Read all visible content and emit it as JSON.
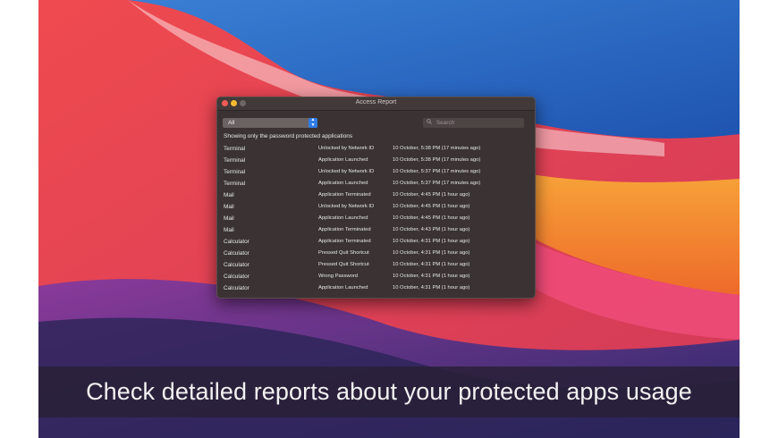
{
  "window": {
    "title": "Access Report"
  },
  "filter": {
    "selected": "All"
  },
  "search": {
    "placeholder": "Search"
  },
  "notice": "Showing only the password protected applications",
  "rows": [
    {
      "app": "Terminal",
      "event": "Unlocked by Network ID",
      "time": "10 October, 5:38 PM (17 minutes ago)"
    },
    {
      "app": "Terminal",
      "event": "Application Launched",
      "time": "10 October, 5:38 PM (17 minutes ago)"
    },
    {
      "app": "Terminal",
      "event": "Unlocked by Network ID",
      "time": "10 October, 5:37 PM (17 minutes ago)"
    },
    {
      "app": "Terminal",
      "event": "Application Launched",
      "time": "10 October, 5:37 PM (17 minutes ago)"
    },
    {
      "app": "Mail",
      "event": "Application Terminated",
      "time": "10 October, 4:45 PM (1 hour ago)"
    },
    {
      "app": "Mail",
      "event": "Unlocked by Network ID",
      "time": "10 October, 4:45 PM (1 hour ago)"
    },
    {
      "app": "Mail",
      "event": "Application Launched",
      "time": "10 October, 4:45 PM (1 hour ago)"
    },
    {
      "app": "Mail",
      "event": "Application Terminated",
      "time": "10 October, 4:43 PM (1 hour ago)"
    },
    {
      "app": "Calculator",
      "event": "Application Terminated",
      "time": "10 October, 4:31 PM (1 hour ago)"
    },
    {
      "app": "Calculator",
      "event": "Pressed Quit Shortcut",
      "time": "10 October, 4:31 PM (1 hour ago)"
    },
    {
      "app": "Calculator",
      "event": "Pressed Quit Shortcut",
      "time": "10 October, 4:31 PM (1 hour ago)"
    },
    {
      "app": "Calculator",
      "event": "Wrong Password",
      "time": "10 October, 4:31 PM (1 hour ago)"
    },
    {
      "app": "Calculator",
      "event": "Application Launched",
      "time": "10 October, 4:31 PM (1 hour ago)"
    }
  ],
  "caption": "Check detailed reports about your protected apps usage",
  "icons": {
    "search": "search-icon",
    "select": "updown-chevron-icon"
  },
  "colors": {
    "accent": "#2f7ce9",
    "close": "#ee5c55",
    "minimize": "#f5bc2f"
  }
}
